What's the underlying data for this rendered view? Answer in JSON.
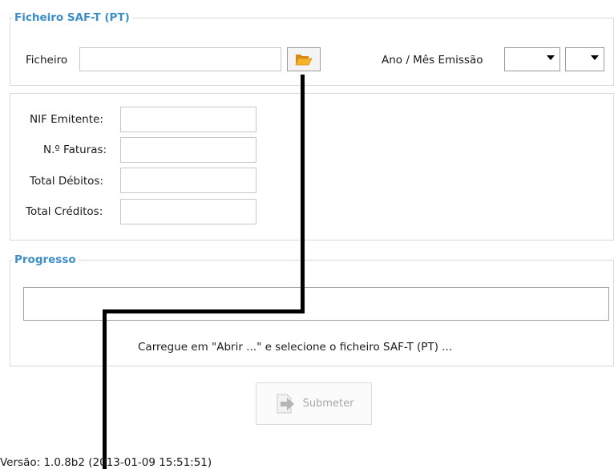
{
  "file_section": {
    "legend": "Ficheiro SAF-T (PT)",
    "file_label": "Ficheiro",
    "file_value": "",
    "open_icon": "folder-open-icon",
    "period_label": "Ano / Mês Emissão",
    "year_value": "",
    "month_value": ""
  },
  "summary": {
    "nif_label": "NIF Emitente:",
    "invoices_label": "N.º Faturas:",
    "debits_label": "Total Débitos:",
    "credits_label": "Total Créditos:",
    "nif_value": "",
    "invoices_value": "",
    "debits_value": "",
    "credits_value": ""
  },
  "progress_section": {
    "legend": "Progresso",
    "progress": 0,
    "message": "Carregue em \"Abrir ...\" e selecione o ficheiro SAF-T (PT) ..."
  },
  "submit": {
    "label": "Submeter",
    "icon": "submit-arrow-icon"
  },
  "footer": {
    "version": "Versão: 1.0.8b2 (2013-01-09 15:51:51)"
  },
  "colors": {
    "legend": "#3c8fc7",
    "folder": "#f0a020",
    "annotation": "#000000"
  }
}
